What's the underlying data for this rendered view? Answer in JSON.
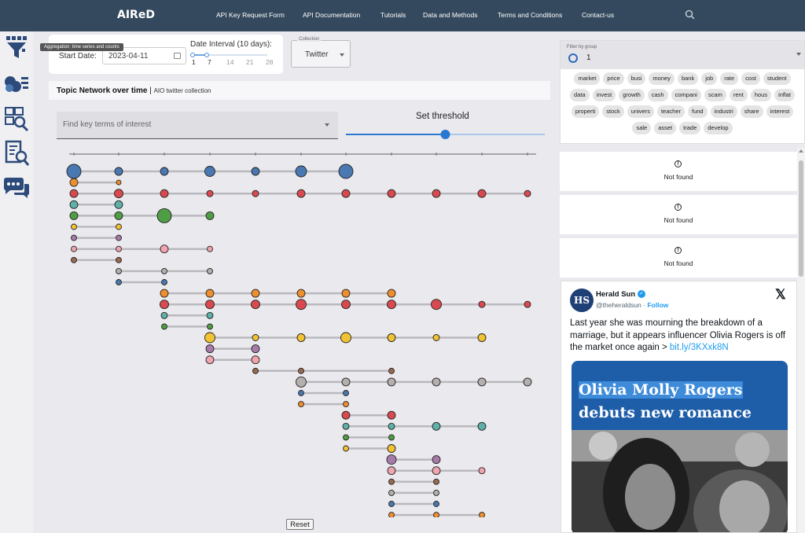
{
  "app": {
    "brand": "AIReD"
  },
  "nav": {
    "items": [
      "API Key Request Form",
      "API Documentation",
      "Tutorials",
      "Data and Methods",
      "Terms and Conditions",
      "Contact-us"
    ]
  },
  "sidebar": {
    "icons": [
      "filter-funnel-icon",
      "topic-bubbles-icon",
      "abc-search-icon",
      "document-search-icon",
      "chat-bubbles-icon"
    ],
    "tooltip": "Aggregation: time series and counts"
  },
  "controls": {
    "start_label": "Start Date:",
    "start_date": "2023-04-11",
    "interval_label": "Date Interval (10 days):",
    "interval_ticks": [
      "1",
      "7",
      "14",
      "21",
      "28"
    ],
    "interval_value": 7,
    "collection_legend": "Collection",
    "collection_value": "Twitter"
  },
  "network": {
    "title": "Topic Network over time",
    "subtitle": "AIO twitter collection",
    "search_placeholder": "Find key terms of interest",
    "threshold_label": "Set threshold",
    "threshold_value": 0.5,
    "reset_label": "Reset"
  },
  "colors": {
    "blue": "#4a78b0",
    "orange": "#ed8f2e",
    "red": "#d94a50",
    "teal": "#5fb0a8",
    "green": "#4f9e45",
    "yellow": "#f1c232",
    "purple": "#a77aa8",
    "pink": "#f0a5ae",
    "brown": "#9a6a50",
    "gray": "#b5b0ad"
  },
  "group_filter": {
    "label": "Filter by group",
    "value": "1",
    "chips": [
      [
        "market",
        "price",
        "busi",
        "money",
        "bank",
        "job",
        "rate",
        "cost",
        "student"
      ],
      [
        "data",
        "invest",
        "growth",
        "cash",
        "compani",
        "scam",
        "rent",
        "hous",
        "inflat"
      ],
      [
        "properti",
        "stock",
        "univers",
        "teacher",
        "fund",
        "industri",
        "share",
        "interest"
      ],
      [
        "sale",
        "asset",
        "trade",
        "develop"
      ]
    ]
  },
  "results": {
    "not_found": "Not found"
  },
  "tweet": {
    "avatar": "HS",
    "name": "Herald Sun",
    "handle": "@theheraldsun",
    "sep": " · ",
    "follow": "Follow",
    "text": "Last year she was mourning the breakdown of a marriage, but it appears influencer Olivia Rogers is off the market once again > ",
    "link": "bit.ly/3KXxk8N",
    "headline1": "Olivia Molly Rogers",
    "headline2": "debuts new romance"
  }
}
